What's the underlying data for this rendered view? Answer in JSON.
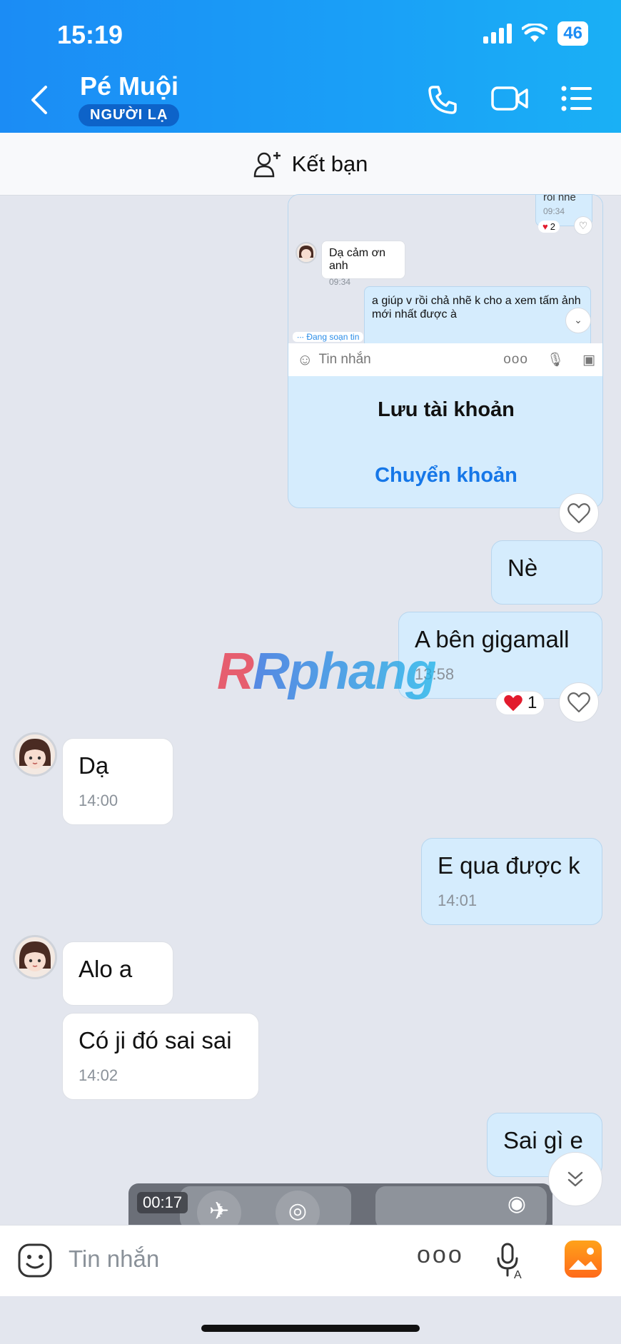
{
  "status": {
    "time": "15:19",
    "battery": "46"
  },
  "header": {
    "name": "Pé Muội",
    "badge": "NGƯỜI LẠ"
  },
  "friend_bar": {
    "label": "Kết bạn"
  },
  "screenshot_card": {
    "prev_text": "rối nhé",
    "prev_time": "09:34",
    "prev_reaction_count": "2",
    "incoming_text": "Dạ cảm ơn anh",
    "incoming_time": "09:34",
    "outgoing_text": "a giúp v rồi chả nhẽ k cho a xem tấm ảnh mới nhất được à",
    "typing": "Đang soạn tin",
    "input_placeholder": "Tin nhắn",
    "input_dots": "ooo",
    "save_label": "Lưu tài khoản",
    "transfer_label": "Chuyển khoản"
  },
  "messages": [
    {
      "dir": "out",
      "text": "Nè",
      "time": ""
    },
    {
      "dir": "out",
      "text": "A bên gigamall",
      "time": "13:58",
      "reaction_count": "1"
    },
    {
      "dir": "in",
      "text": "Dạ",
      "time": "14:00"
    },
    {
      "dir": "out",
      "text": "E qua được k",
      "time": "14:01"
    },
    {
      "dir": "in",
      "text": "Alo a",
      "time": ""
    },
    {
      "dir": "in",
      "text": "Có ji đó sai sai",
      "time": "14:02"
    },
    {
      "dir": "out",
      "text": "Sai gì e",
      "time": ""
    }
  ],
  "video": {
    "duration": "00:17"
  },
  "watermark": "Rphang",
  "composer": {
    "placeholder": "Tin nhắn",
    "dots": "ooo"
  },
  "colors": {
    "accent": "#1b8cf5",
    "outgoing": "#d5ecfd",
    "incoming": "#ffffff",
    "link": "#1677e8"
  }
}
